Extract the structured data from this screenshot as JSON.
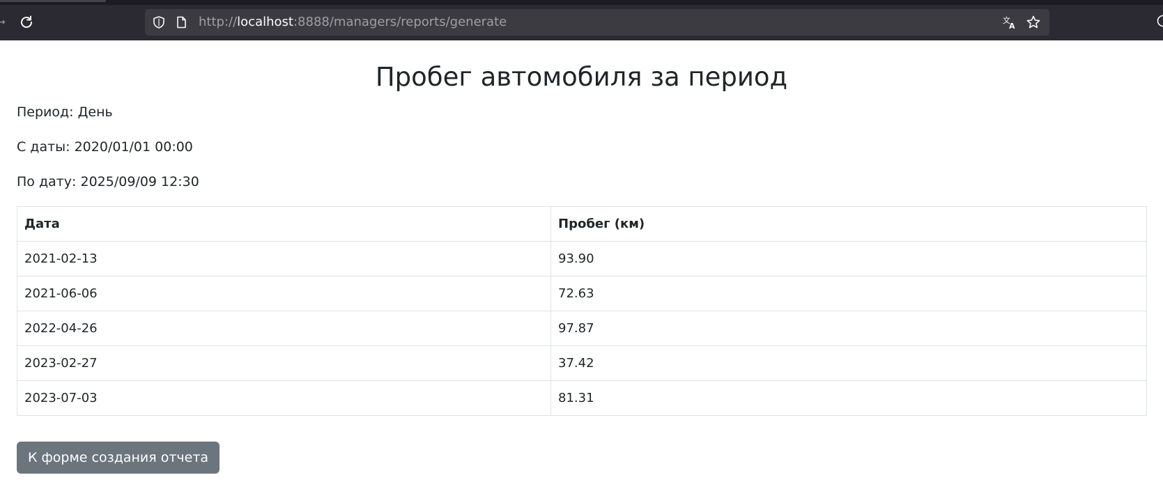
{
  "browser": {
    "url_protocol": "http://",
    "url_host": "localhost",
    "url_rest": ":8888/managers/reports/generate"
  },
  "report": {
    "title": "Пробег автомобиля за период",
    "period": "Период: День",
    "from": "С даты: 2020/01/01 00:00",
    "to": "По дату: 2025/09/09 12:30",
    "columns": [
      "Дата",
      "Пробег (км)"
    ],
    "rows": [
      {
        "date": "2021-02-13",
        "mileage": "93.90"
      },
      {
        "date": "2021-06-06",
        "mileage": "72.63"
      },
      {
        "date": "2022-04-26",
        "mileage": "97.87"
      },
      {
        "date": "2023-02-27",
        "mileage": "37.42"
      },
      {
        "date": "2023-07-03",
        "mileage": "81.31"
      }
    ],
    "back_button_label": "К форме создания отчета"
  },
  "icons": {
    "back": "back-arrow-icon",
    "reload": "reload-icon",
    "shield": "shield-icon",
    "page": "page-icon",
    "translate": "translate-icon",
    "bookmark": "star-icon"
  }
}
